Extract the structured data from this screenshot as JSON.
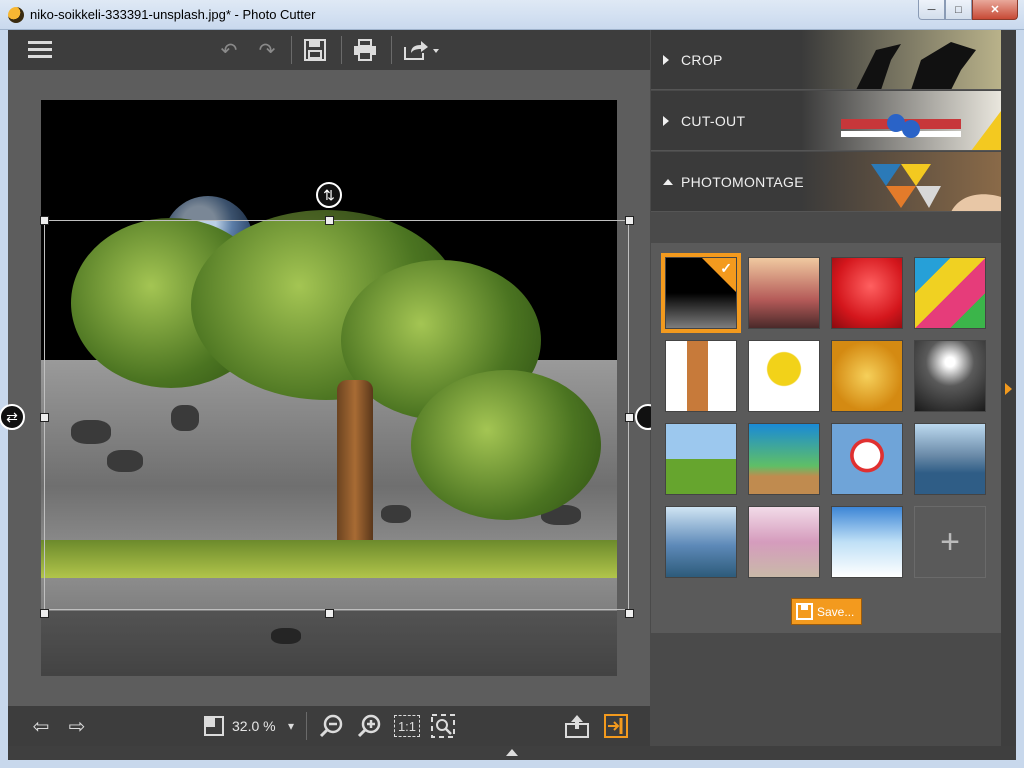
{
  "window": {
    "title": "niko-soikkeli-333391-unsplash.jpg* - Photo Cutter",
    "minimize": "─",
    "maximize": "□",
    "close": "✕"
  },
  "toolbar": {
    "menu_icon": "hamburger-menu-icon",
    "undo_icon": "↶",
    "redo_icon": "↷",
    "save_icon": "💾",
    "print_icon": "🖶",
    "share_icon": "⇪"
  },
  "canvas": {
    "crop_handle_vertical": "⇅",
    "crop_handle_horizontal": "⇄"
  },
  "bottombar": {
    "zoom_value": "32.0 %",
    "zoom_dropdown": "▾",
    "prev_icon": "⇦",
    "next_icon": "⇨",
    "zoom_out_icon": "−",
    "zoom_in_icon": "+",
    "actual_size": "1:1",
    "fit_icon": "⤢"
  },
  "panel": {
    "sections": [
      {
        "label": "CROP"
      },
      {
        "label": "CUT-OUT"
      },
      {
        "label": "PHOTOMONTAGE"
      }
    ],
    "add_label": "+",
    "save_label": "Save..."
  },
  "colors": {
    "accent": "#f39a1e",
    "panel_bg": "#4a4a4a",
    "toolbar_bg": "#3d3d3d"
  }
}
